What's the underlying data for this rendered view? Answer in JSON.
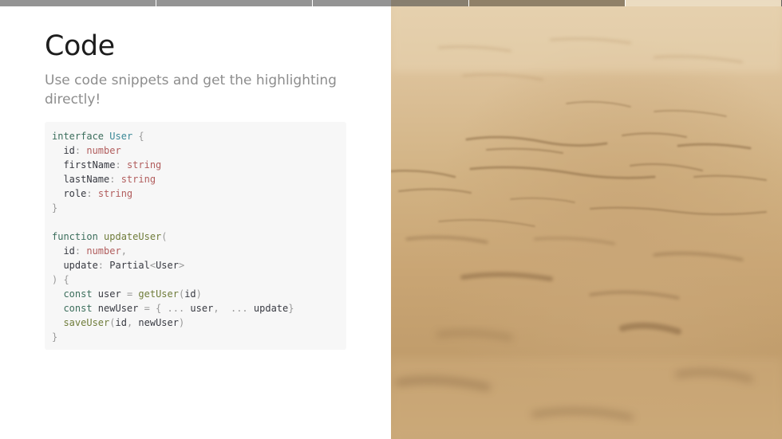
{
  "progress": {
    "segments": [
      "done",
      "done",
      "done",
      "active",
      "upcoming"
    ]
  },
  "slide": {
    "title": "Code",
    "subtitle": "Use code snippets and get the highlighting directly!"
  },
  "code": {
    "lines": [
      [
        {
          "t": "interface",
          "c": "keyword"
        },
        {
          "t": " ",
          "c": "ident"
        },
        {
          "t": "User",
          "c": "type"
        },
        {
          "t": " {",
          "c": "punct"
        }
      ],
      [
        {
          "t": "  id",
          "c": "prop"
        },
        {
          "t": ": ",
          "c": "punct"
        },
        {
          "t": "number",
          "c": "builtin"
        }
      ],
      [
        {
          "t": "  firstName",
          "c": "prop"
        },
        {
          "t": ": ",
          "c": "punct"
        },
        {
          "t": "string",
          "c": "builtin"
        }
      ],
      [
        {
          "t": "  lastName",
          "c": "prop"
        },
        {
          "t": ": ",
          "c": "punct"
        },
        {
          "t": "string",
          "c": "builtin"
        }
      ],
      [
        {
          "t": "  role",
          "c": "prop"
        },
        {
          "t": ": ",
          "c": "punct"
        },
        {
          "t": "string",
          "c": "builtin"
        }
      ],
      [
        {
          "t": "}",
          "c": "punct"
        }
      ],
      [],
      [
        {
          "t": "function",
          "c": "keyword"
        },
        {
          "t": " ",
          "c": "ident"
        },
        {
          "t": "updateUser",
          "c": "func"
        },
        {
          "t": "(",
          "c": "punct"
        }
      ],
      [
        {
          "t": "  id",
          "c": "prop"
        },
        {
          "t": ": ",
          "c": "punct"
        },
        {
          "t": "number",
          "c": "builtin"
        },
        {
          "t": ",",
          "c": "punct"
        }
      ],
      [
        {
          "t": "  update",
          "c": "prop"
        },
        {
          "t": ": ",
          "c": "punct"
        },
        {
          "t": "Partial",
          "c": "ident"
        },
        {
          "t": "<",
          "c": "punct"
        },
        {
          "t": "User",
          "c": "ident"
        },
        {
          "t": ">",
          "c": "punct"
        }
      ],
      [
        {
          "t": ") {",
          "c": "punct"
        }
      ],
      [
        {
          "t": "  const",
          "c": "keyword"
        },
        {
          "t": " user ",
          "c": "ident"
        },
        {
          "t": "= ",
          "c": "punct"
        },
        {
          "t": "getUser",
          "c": "func"
        },
        {
          "t": "(",
          "c": "punct"
        },
        {
          "t": "id",
          "c": "ident"
        },
        {
          "t": ")",
          "c": "punct"
        }
      ],
      [
        {
          "t": "  const",
          "c": "keyword"
        },
        {
          "t": " newUser ",
          "c": "ident"
        },
        {
          "t": "= { ... ",
          "c": "punct"
        },
        {
          "t": "user",
          "c": "ident"
        },
        {
          "t": ",  ... ",
          "c": "punct"
        },
        {
          "t": "update",
          "c": "ident"
        },
        {
          "t": "}",
          "c": "punct"
        }
      ],
      [
        {
          "t": "  saveUser",
          "c": "func"
        },
        {
          "t": "(",
          "c": "punct"
        },
        {
          "t": "id",
          "c": "ident"
        },
        {
          "t": ", ",
          "c": "punct"
        },
        {
          "t": "newUser",
          "c": "ident"
        },
        {
          "t": ")",
          "c": "punct"
        }
      ],
      [
        {
          "t": "}",
          "c": "punct"
        }
      ]
    ]
  },
  "colors": {
    "keyword": "#3c6e5c",
    "type": "#3a8896",
    "builtin": "#b15d5d",
    "func": "#6f7c3a",
    "punct": "#999999",
    "text": "#383a42",
    "code_bg": "#f7f7f7",
    "sand": "#d2b384"
  },
  "image": {
    "icon": "sand-photo"
  }
}
